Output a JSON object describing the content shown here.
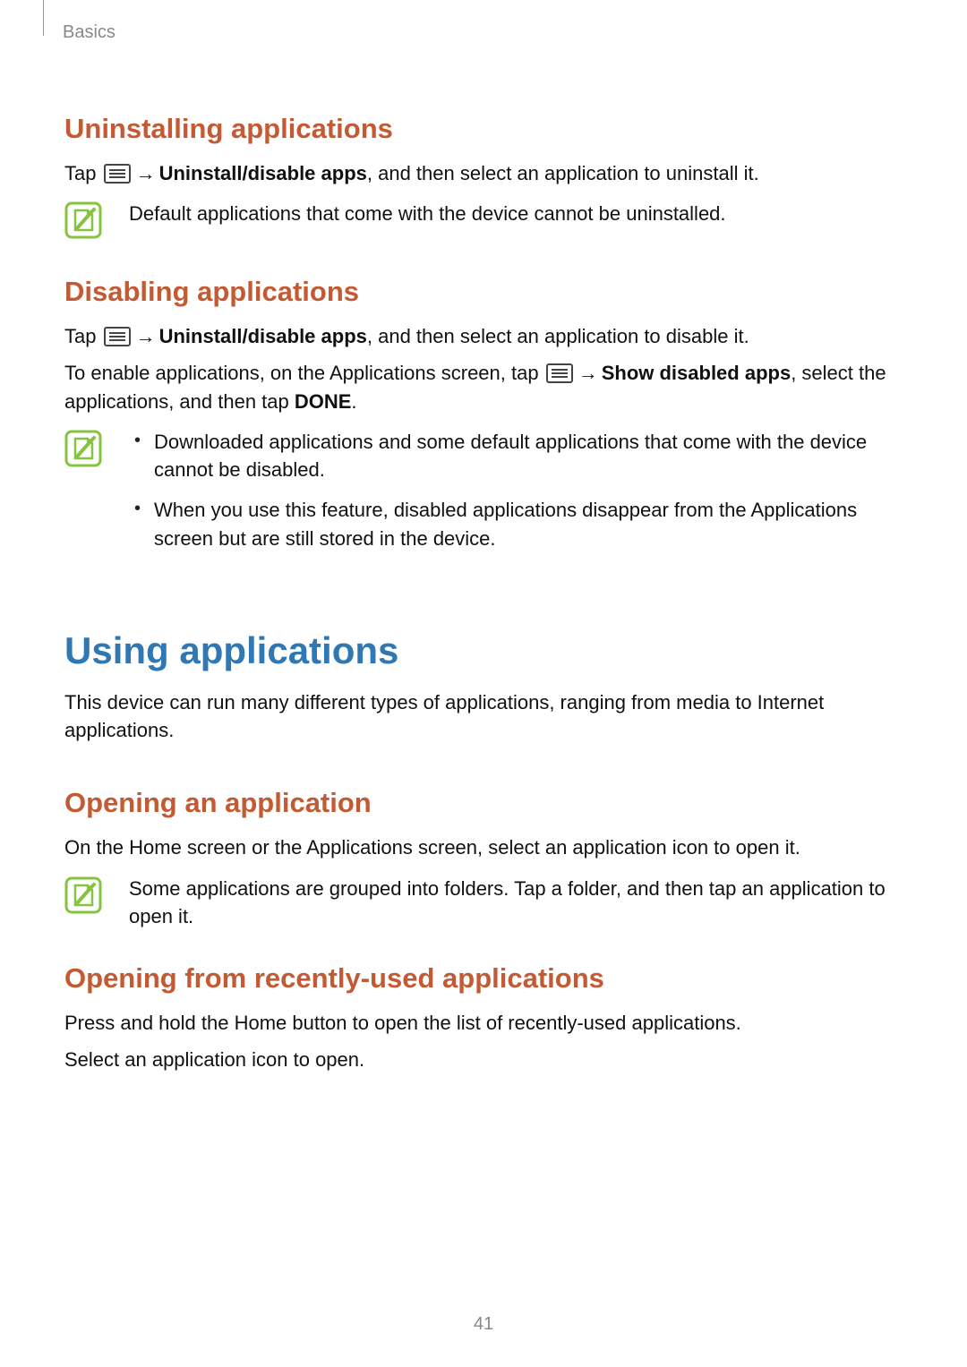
{
  "header": {
    "section": "Basics"
  },
  "sections": {
    "uninstalling": {
      "title": "Uninstalling applications",
      "tap_prefix": "Tap ",
      "link_label": "Uninstall/disable apps",
      "tap_suffix": ", and then select an application to uninstall it.",
      "note": "Default applications that come with the device cannot be uninstalled."
    },
    "disabling": {
      "title": "Disabling applications",
      "tap_prefix": "Tap ",
      "link_label1": "Uninstall/disable apps",
      "tap_suffix1": ", and then select an application to disable it.",
      "enable_prefix": "To enable applications, on the Applications screen, tap ",
      "link_label2": "Show disabled apps",
      "enable_mid": ", select the applications, and then tap ",
      "done_label": "DONE",
      "enable_end": ".",
      "bullets": [
        "Downloaded applications and some default applications that come with the device cannot be disabled.",
        "When you use this feature, disabled applications disappear from the Applications screen but are still stored in the device."
      ]
    },
    "using": {
      "title": "Using applications",
      "intro": "This device can run many different types of applications, ranging from media to Internet applications."
    },
    "opening": {
      "title": "Opening an application",
      "body": "On the Home screen or the Applications screen, select an application icon to open it.",
      "note": "Some applications are grouped into folders. Tap a folder, and then tap an application to open it."
    },
    "recent": {
      "title": "Opening from recently-used applications",
      "body1": "Press and hold the Home button to open the list of recently-used applications.",
      "body2": "Select an application icon to open."
    }
  },
  "symbols": {
    "arrow": "→"
  },
  "footer": {
    "page_number": "41"
  }
}
